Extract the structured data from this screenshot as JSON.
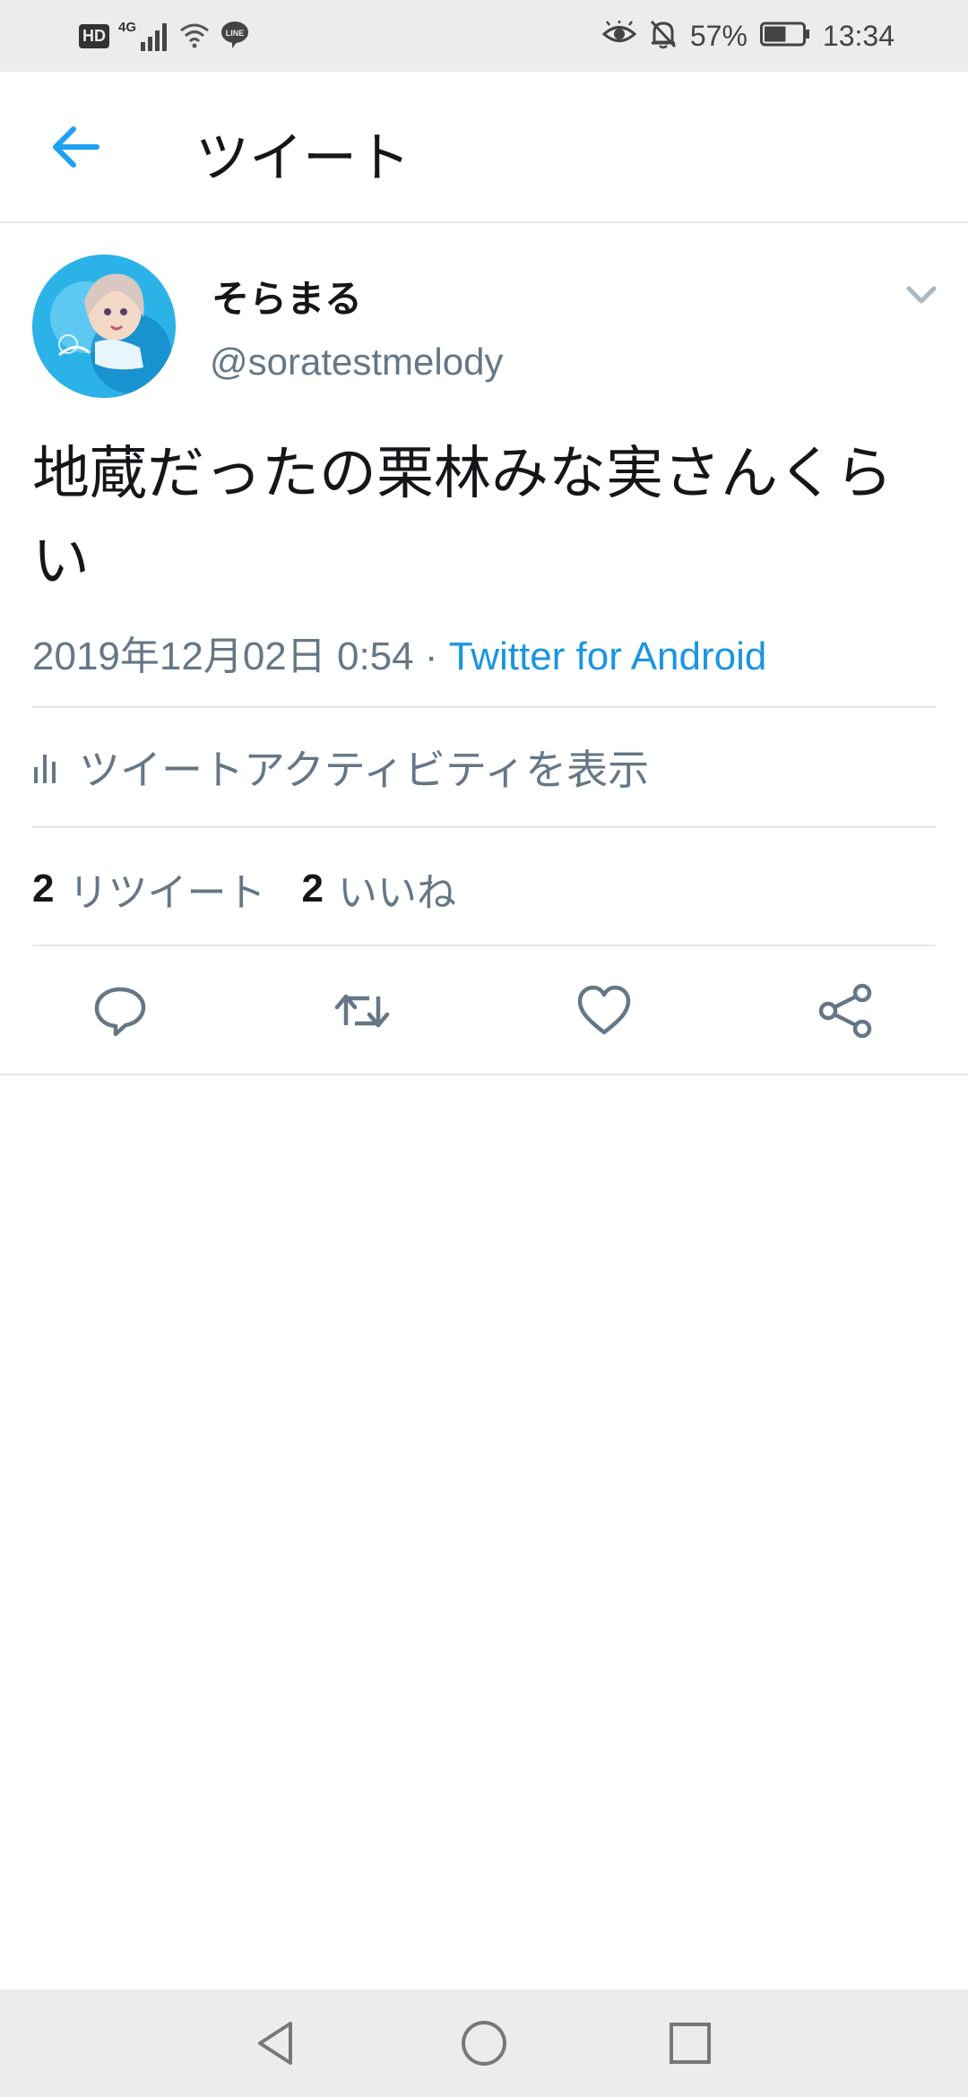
{
  "status_bar": {
    "hd_label": "HD",
    "network_label": "4G",
    "battery_percent": "57%",
    "time": "13:34",
    "icons": [
      "hd-icon",
      "signal-icon",
      "wifi-icon",
      "line-icon",
      "eye-icon",
      "bell-off-icon",
      "battery-icon"
    ],
    "battery_level": 0.57
  },
  "header": {
    "title": "ツイート",
    "back_icon": "arrow-left-icon",
    "accent_color": "#1da1f2"
  },
  "tweet": {
    "display_name": "そらまる",
    "handle": "@soratestmelody",
    "text": "地蔵だったの栗林みな実さんくらい",
    "timestamp": "2019年12月02日 0:54",
    "separator": " · ",
    "client": "Twitter for Android",
    "activity_label": "ツイートアクティビティを表示",
    "retweet_count": "2",
    "retweet_label": "リツイート",
    "like_count": "2",
    "like_label": "いいね",
    "actions": [
      "reply-icon",
      "retweet-icon",
      "like-icon",
      "share-icon"
    ]
  },
  "nav_bar": {
    "buttons": [
      "back-triangle-icon",
      "home-circle-icon",
      "recents-square-icon"
    ]
  },
  "colors": {
    "primary_text": "#14171a",
    "secondary_text": "#657786",
    "link": "#1b95e0",
    "divider": "#e1e8ed"
  }
}
